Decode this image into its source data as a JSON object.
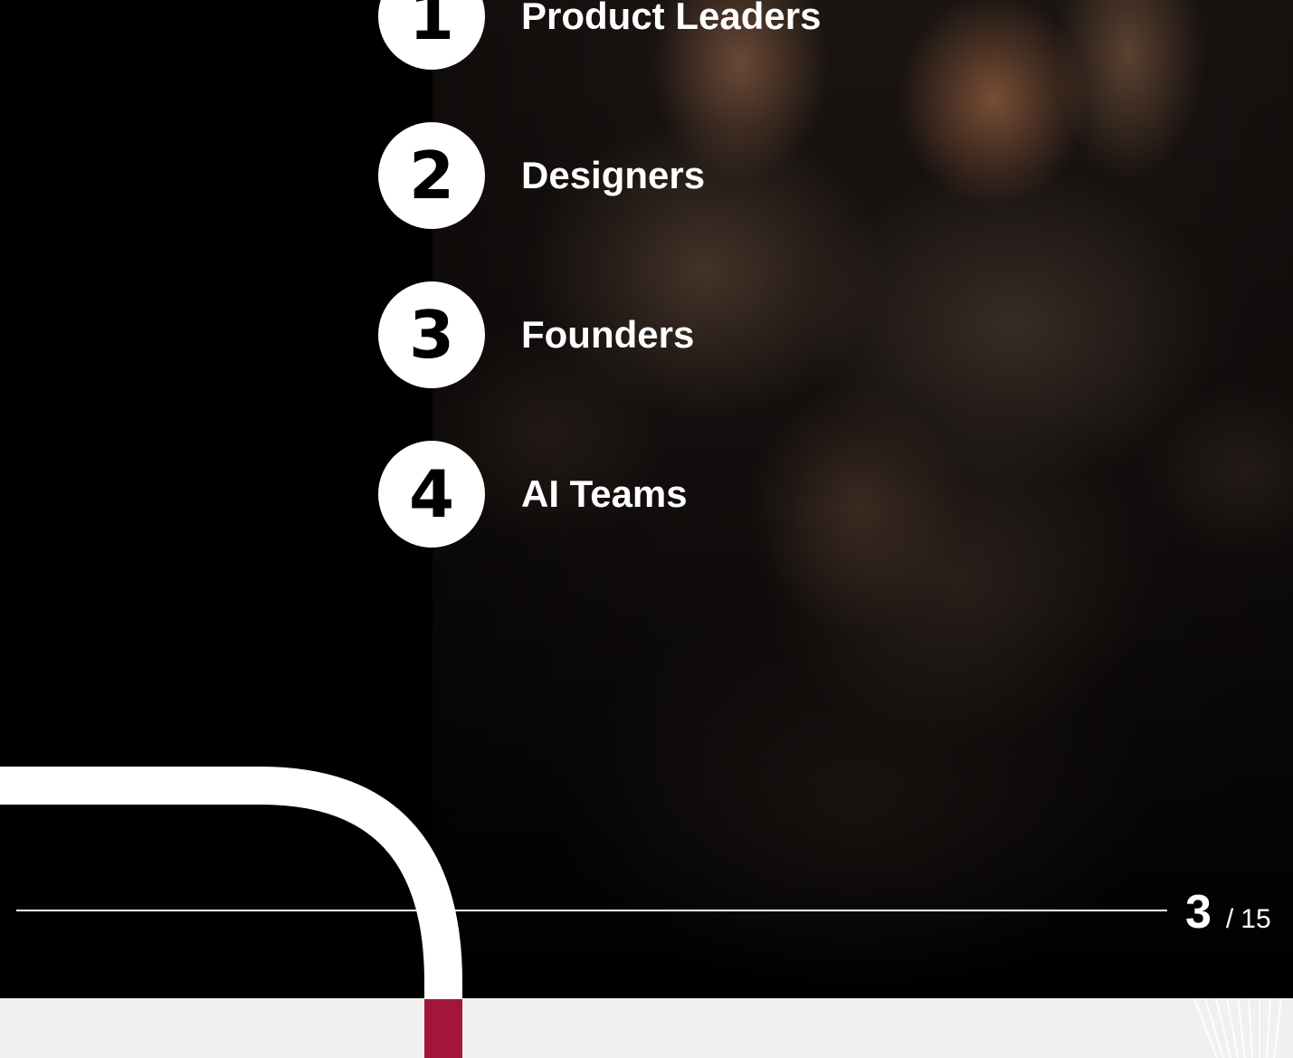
{
  "audience": {
    "items": [
      {
        "number": "1",
        "label": "Product Leaders"
      },
      {
        "number": "2",
        "label": "Designers"
      },
      {
        "number": "3",
        "label": "Founders"
      },
      {
        "number": "4",
        "label": "AI Teams"
      }
    ]
  },
  "pager": {
    "current": "3",
    "separator": "/",
    "total": "15"
  },
  "colors": {
    "background": "#000000",
    "accent": "#a4153a",
    "band": "#f0f0f0",
    "foreground": "#ffffff"
  }
}
